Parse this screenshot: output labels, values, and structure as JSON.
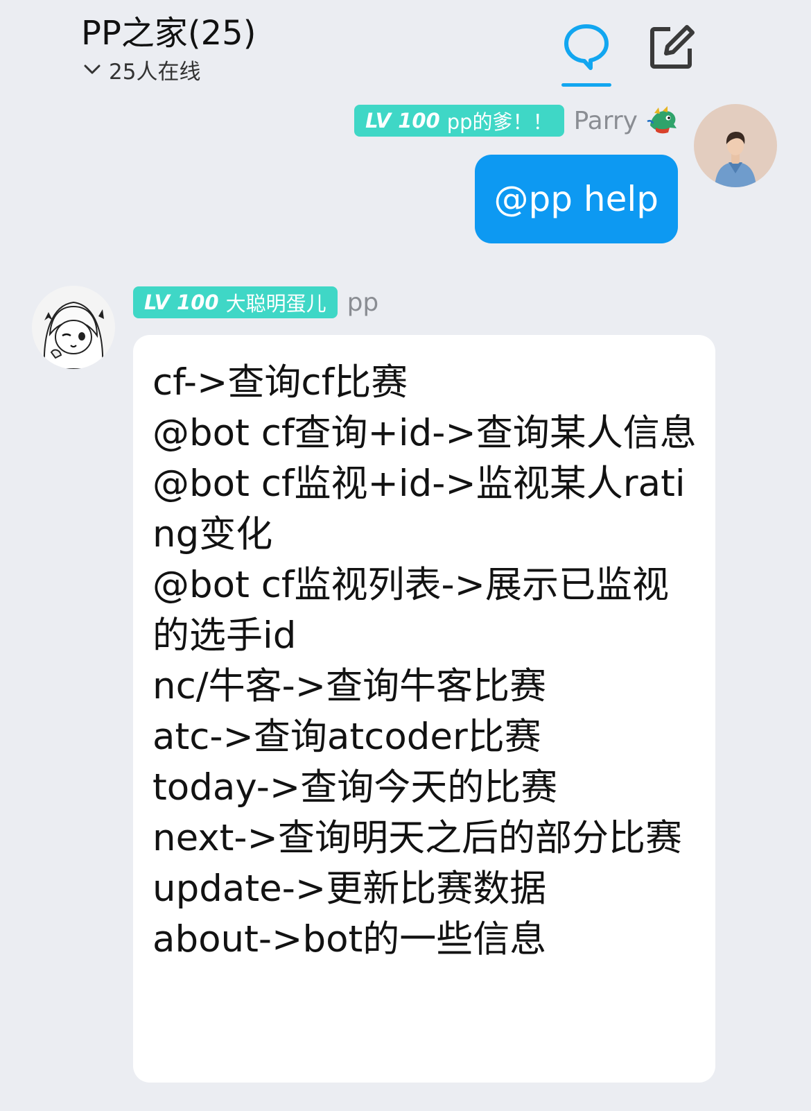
{
  "header": {
    "group_title": "PP之家(25)",
    "online_count": "25人在线",
    "accent_color": "#12a6f0"
  },
  "messages": {
    "outgoing": {
      "badge_level": "LV 100",
      "badge_title": "pp的爹！！",
      "sender_name": "Parry",
      "text": "@pp help",
      "bubble_color": "#0d99f2"
    },
    "incoming": {
      "badge_level": "LV 100",
      "badge_title": "大聪明蛋儿",
      "sender_name": "pp",
      "lines": [
        "cf->查询cf比赛",
        "@bot cf查询+id->查询某人信息",
        "@bot cf监视+id->监视某人rating变化",
        "@bot cf监视列表->展示已监视的选手id",
        "nc/牛客->查询牛客比赛",
        "atc->查询atcoder比赛",
        "today->查询今天的比赛",
        "next->查询明天之后的部分比赛",
        "update->更新比赛数据",
        "about->bot的一些信息"
      ]
    }
  },
  "badge_color": "#3fd7c6",
  "icons": {
    "chevron": "chevron-down-icon",
    "chat": "chat-bubble-icon",
    "edit": "edit-icon",
    "dragon": "dragon-icon"
  }
}
